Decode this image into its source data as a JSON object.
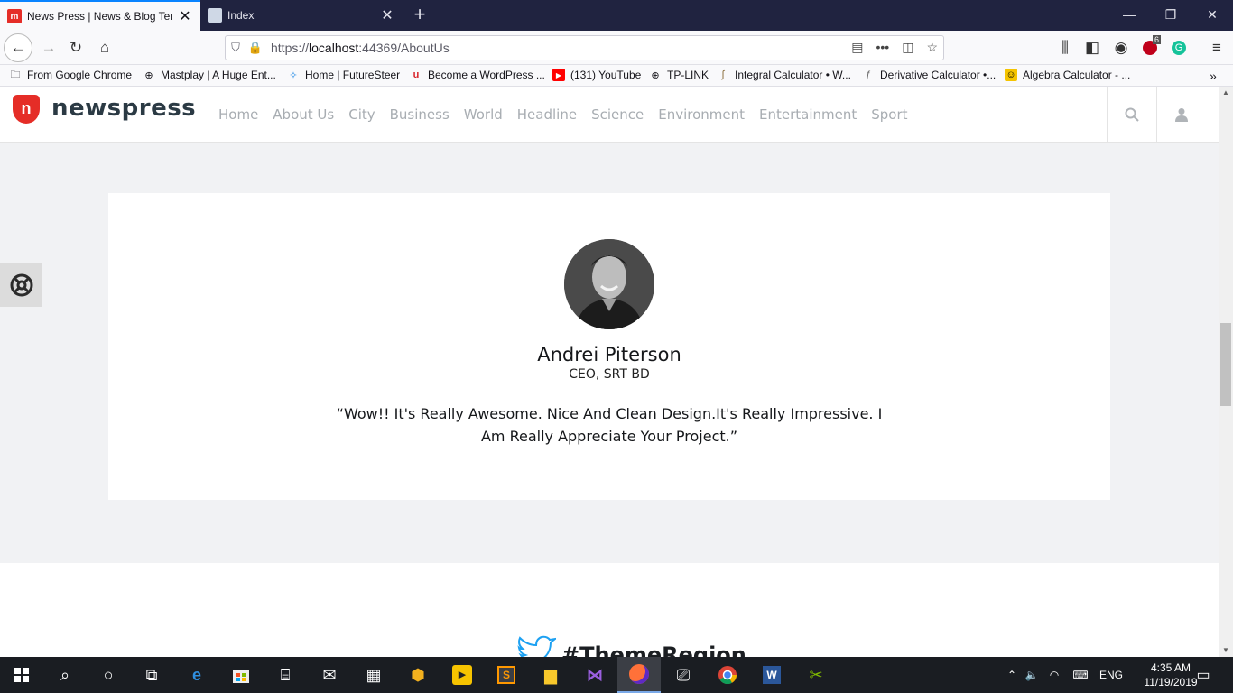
{
  "browser": {
    "tabs": [
      {
        "title": "News Press | News & Blog Tem",
        "active": true
      },
      {
        "title": "Index",
        "active": false
      }
    ],
    "url_prefix": "https://",
    "url_host": "localhost",
    "url_rest": ":44369/AboutUs",
    "reader_badge": "6",
    "bookmarks": [
      "From Google Chrome",
      "Mastplay | A Huge Ent...",
      "Home | FutureSteer",
      "Become a WordPress ...",
      "(131) YouTube",
      "TP-LINK",
      "Integral Calculator • W...",
      "Derivative Calculator •...",
      "Algebra Calculator - ..."
    ]
  },
  "site": {
    "logo_mark": "n",
    "logo_text": "newspress",
    "nav": [
      "Home",
      "About Us",
      "City",
      "Business",
      "World",
      "Headline",
      "Science",
      "Environment",
      "Entertainment",
      "Sport"
    ]
  },
  "testimonial": {
    "name": "Andrei Piterson",
    "role": "CEO, SRT BD",
    "quote": "“Wow!! It's Really Awesome. Nice And Clean Design.It's Really Impressive. I Am Really Appreciate Your Project.”"
  },
  "twitter": {
    "handle": "#ThemeRegion"
  },
  "taskbar": {
    "language": "ENG",
    "time": "4:35 AM",
    "date": "11/19/2019"
  }
}
